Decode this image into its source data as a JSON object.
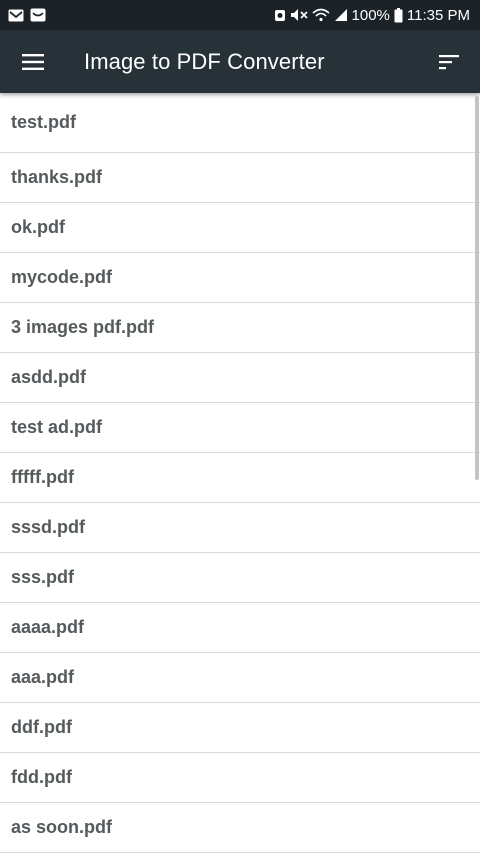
{
  "status_bar": {
    "battery": "100%",
    "time": "11:35 PM"
  },
  "app_bar": {
    "title": "Image to PDF Converter",
    "menu_icon": "hamburger-menu-icon",
    "sort_icon": "sort-icon"
  },
  "files": [
    "test.pdf",
    "thanks.pdf",
    "ok.pdf",
    "mycode.pdf",
    "3 images pdf.pdf",
    "asdd.pdf",
    "test ad.pdf",
    "fffff.pdf",
    "sssd.pdf",
    "sss.pdf",
    "aaaa.pdf",
    "aaa.pdf",
    "ddf.pdf",
    "fdd.pdf",
    "as soon.pdf"
  ],
  "colors": {
    "status_bar": "#1b2328",
    "app_bar": "#263238",
    "item_text": "#555a5d",
    "divider": "#d9d9d9"
  }
}
